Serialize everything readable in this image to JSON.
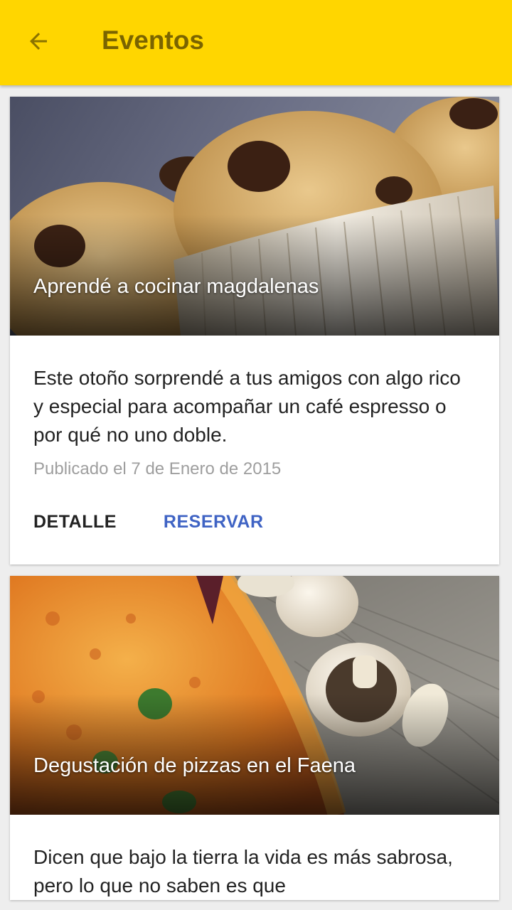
{
  "appbar": {
    "title": "Eventos",
    "back_icon": "arrow-back-icon",
    "background": "#FFD600"
  },
  "cards": [
    {
      "image": "muffins-photo",
      "title": "Aprendé a cocinar magdalenas",
      "description": "Este otoño sorprendé a tus amigos con algo rico y especial para acompañar un café espresso o por qué no uno doble.",
      "date": "Publicado el 7 de Enero de 2015",
      "actions": {
        "detail": "DETALLE",
        "reserve": "RESERVAR"
      }
    },
    {
      "image": "pizza-mushrooms-photo",
      "title": "Degustación de pizzas en el Faena",
      "description": "Dicen que bajo la tierra la vida es más sabrosa, pero lo que no saben es que"
    }
  ],
  "colors": {
    "accent": "#FFD600",
    "link": "#3f63c4"
  }
}
